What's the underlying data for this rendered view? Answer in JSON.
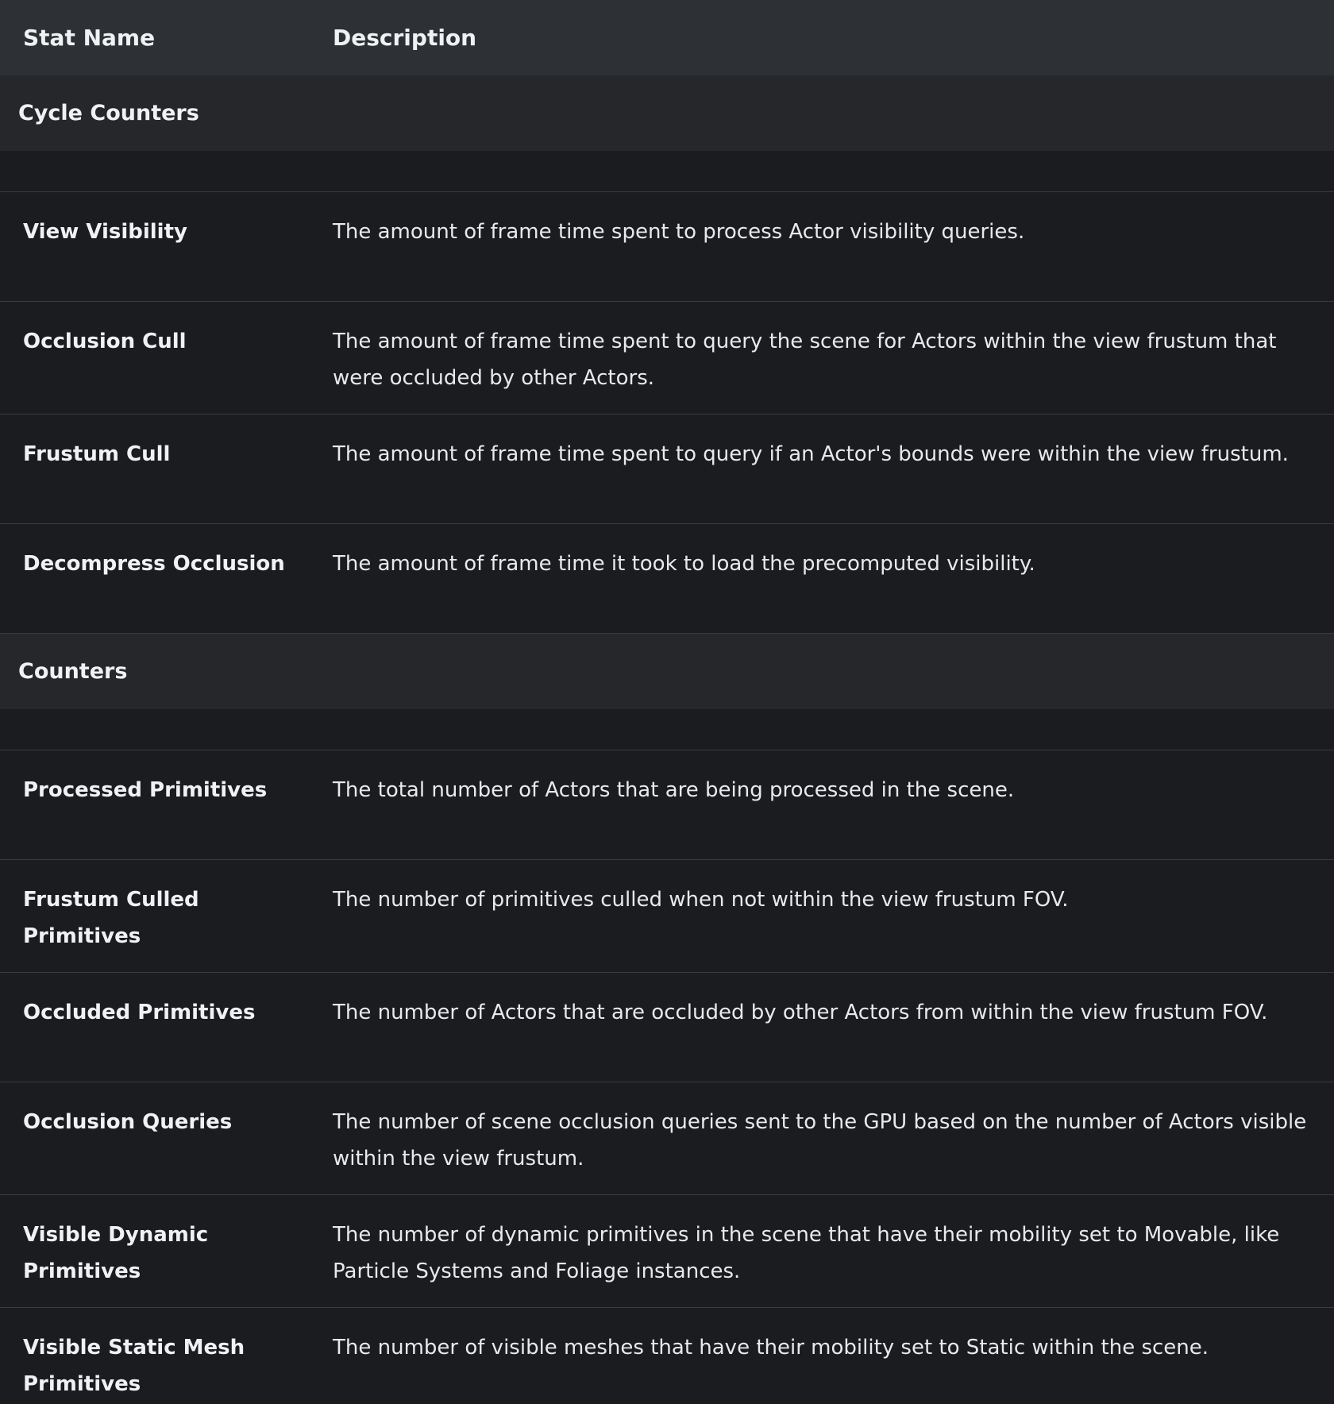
{
  "table": {
    "headers": {
      "name": "Stat Name",
      "description": "Description"
    },
    "sections": [
      {
        "title": "Cycle Counters",
        "rows": [
          {
            "name": "View Visibility",
            "description": "The amount of frame time spent to process Actor visibility queries."
          },
          {
            "name": "Occlusion Cull",
            "description": "The amount of frame time spent to query the scene for Actors within the view frustum that were occluded by other Actors."
          },
          {
            "name": "Frustum Cull",
            "description": "The amount of frame time spent to query if an Actor's bounds were within the view frustum."
          },
          {
            "name": "Decompress Occlusion",
            "description": "The amount of frame time it took to load the precomputed visibility."
          }
        ]
      },
      {
        "title": "Counters",
        "rows": [
          {
            "name": "Processed Primitives",
            "description": "The total number of Actors that are being processed in the scene."
          },
          {
            "name": "Frustum Culled Primitives",
            "description": "The number of primitives culled when not within the view frustum FOV."
          },
          {
            "name": "Occluded Primitives",
            "description": "The number of Actors that are occluded by other Actors from within the view frustum FOV."
          },
          {
            "name": "Occlusion Queries",
            "description": "The number of scene occlusion queries sent to the GPU based on the number of Actors visible within the view frustum."
          },
          {
            "name": "Visible Dynamic Primitives",
            "description": "The number of dynamic primitives in the scene that have their mobility set to Movable, like Particle Systems and Foliage instances."
          },
          {
            "name": "Visible Static Mesh Primitives",
            "description": "The number of visible meshes that have their mobility set to Static within the scene."
          }
        ]
      }
    ]
  }
}
